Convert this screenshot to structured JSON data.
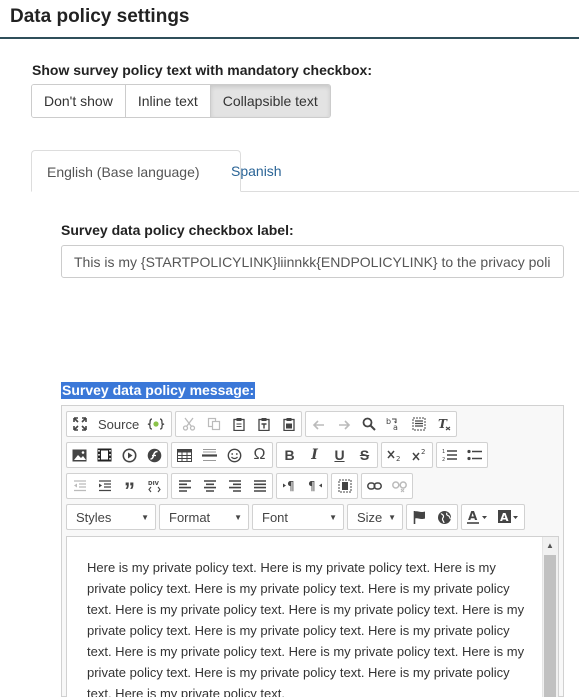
{
  "page": {
    "title": "Data policy settings"
  },
  "show_policy": {
    "label": "Show survey policy text with mandatory checkbox:",
    "options": [
      "Don't show",
      "Inline text",
      "Collapsible text"
    ],
    "selected": "Collapsible text"
  },
  "tabs": [
    "English (Base language)",
    "Spanish"
  ],
  "checkbox_label": {
    "label": "Survey data policy checkbox label:",
    "value": "This is my {STARTPOLICYLINK}liinnkk{ENDPOLICYLINK} to the privacy policy"
  },
  "message": {
    "label": "Survey data policy message:",
    "toolbar": {
      "source_label": "Source",
      "styles_label": "Styles",
      "format_label": "Format",
      "font_label": "Font",
      "size_label": "Size"
    },
    "content": "Here is my private policy text. Here is my private policy text. Here is my private policy text. Here is my private policy text. Here is my private policy text. Here is my private policy text. Here is my private policy text. Here is my private policy text. Here is my private policy text. Here is my private policy text. Here is my private policy text. Here is my private policy text. Here is my private policy text. Here is my private policy text. Here is my private policy text. Here is my private policy text."
  },
  "colors": {
    "accent": "#2a6496",
    "selection": "#3b78d8",
    "rule": "#2f4f5a"
  }
}
